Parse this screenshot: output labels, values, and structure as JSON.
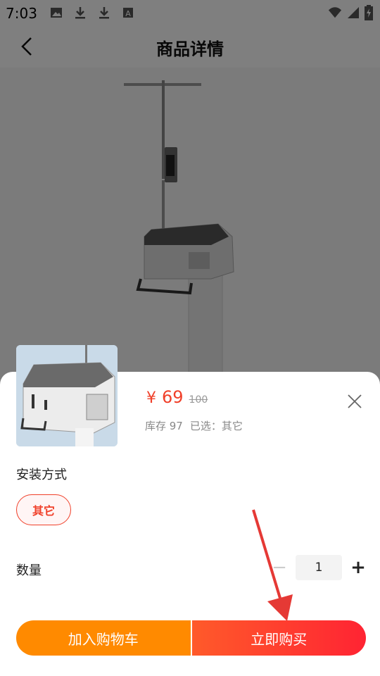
{
  "status_bar": {
    "time": "7:03",
    "left_icons": [
      "image-icon",
      "download-icon",
      "download-icon",
      "text-icon"
    ],
    "right_icons": [
      "wifi-icon",
      "signal-icon",
      "battery-charging-icon"
    ]
  },
  "header": {
    "title": "商品详情",
    "back_icon": "chevron-left-icon"
  },
  "sheet": {
    "price_symbol": "¥",
    "price": "69",
    "original_price": "100",
    "stock_label": "库存 97",
    "selected_label": "已选：其它",
    "close_icon": "close-icon",
    "install_section_label": "安装方式",
    "install_options": [
      "其它"
    ],
    "install_selected": "其它",
    "quantity_label": "数量",
    "quantity_value": "1",
    "minus_symbol": "−",
    "plus_symbol": "+",
    "add_to_cart_label": "加入购物车",
    "buy_now_label": "立即购买"
  },
  "colors": {
    "price": "#f0402a",
    "cart_button": "#ff8a00",
    "buy_button_start": "#ff5a2a",
    "buy_button_end": "#ff2433",
    "annotation_arrow": "#e53935"
  }
}
